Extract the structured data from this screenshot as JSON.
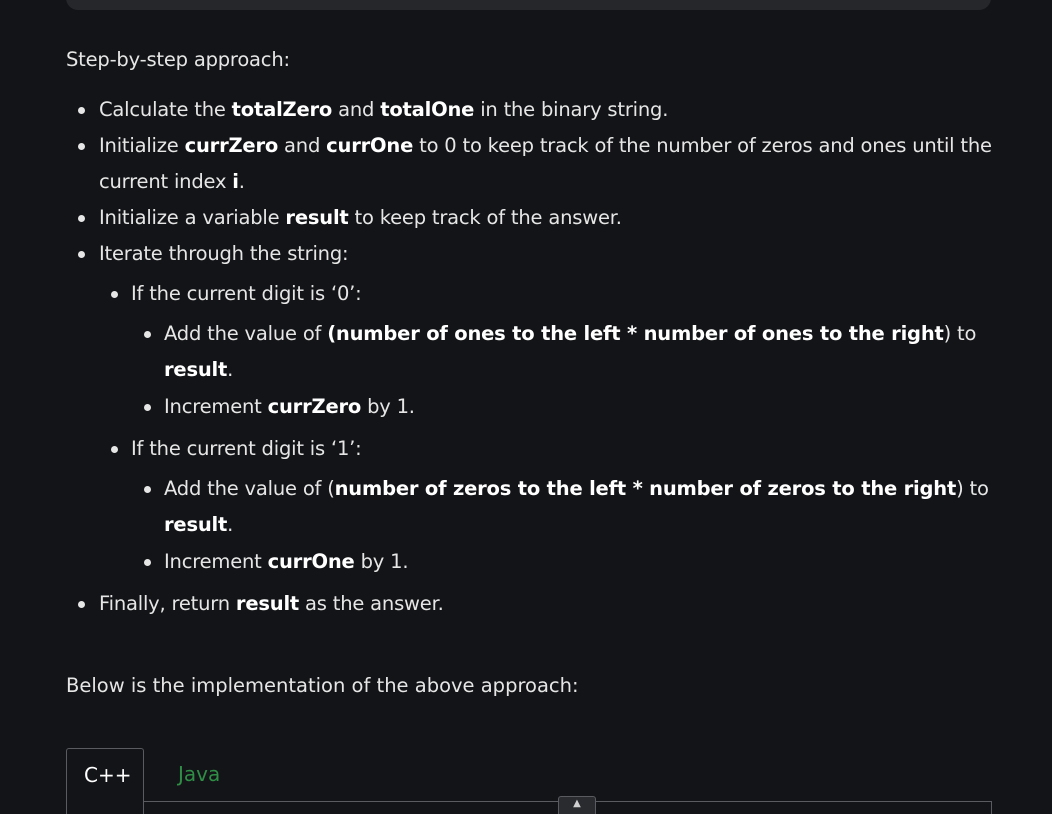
{
  "intro": "Step-by-step approach:",
  "steps": [
    {
      "segments": [
        "Calculate the ",
        "totalZero",
        " and ",
        "totalOne",
        " in the binary string."
      ]
    },
    {
      "segments": [
        "Initialize ",
        "currZero",
        " and ",
        "currOne",
        " to 0 to keep track of the number of zeros and ones until the current index ",
        "i",
        "."
      ]
    },
    {
      "segments": [
        "Initialize a variable ",
        "result",
        " to keep track of the answer."
      ]
    },
    {
      "text": "Iterate through the string:"
    },
    {
      "segments": [
        "Finally, return ",
        "result",
        " as the answer."
      ]
    }
  ],
  "iterate": [
    {
      "text": "If the current digit is ‘0’:",
      "sub": [
        {
          "segments": [
            "Add the value of ",
            "(number of ones to the left * number of ones to the right",
            ") to ",
            "result",
            "."
          ]
        },
        {
          "segments": [
            "Increment ",
            "currZero",
            " by 1."
          ]
        }
      ]
    },
    {
      "text": "If the current digit is ‘1’:",
      "sub": [
        {
          "segments": [
            "Add the value of (",
            "number of zeros to the left * number of zeros to the right",
            ") to ",
            "result",
            "."
          ]
        },
        {
          "segments": [
            "Increment ",
            "currOne",
            " by 1."
          ]
        }
      ]
    }
  ],
  "outro": "Below is the implementation of the above approach:",
  "tabs": {
    "cpp": "C++",
    "java": "Java"
  },
  "colors": {
    "background": "#131417",
    "text": "#e6e6e6",
    "active_tab_text": "#ffffff",
    "inactive_tab_text": "#2f8d46",
    "border": "#5a5b60"
  },
  "icons": {
    "scroll_up": "chevron-up-icon"
  }
}
